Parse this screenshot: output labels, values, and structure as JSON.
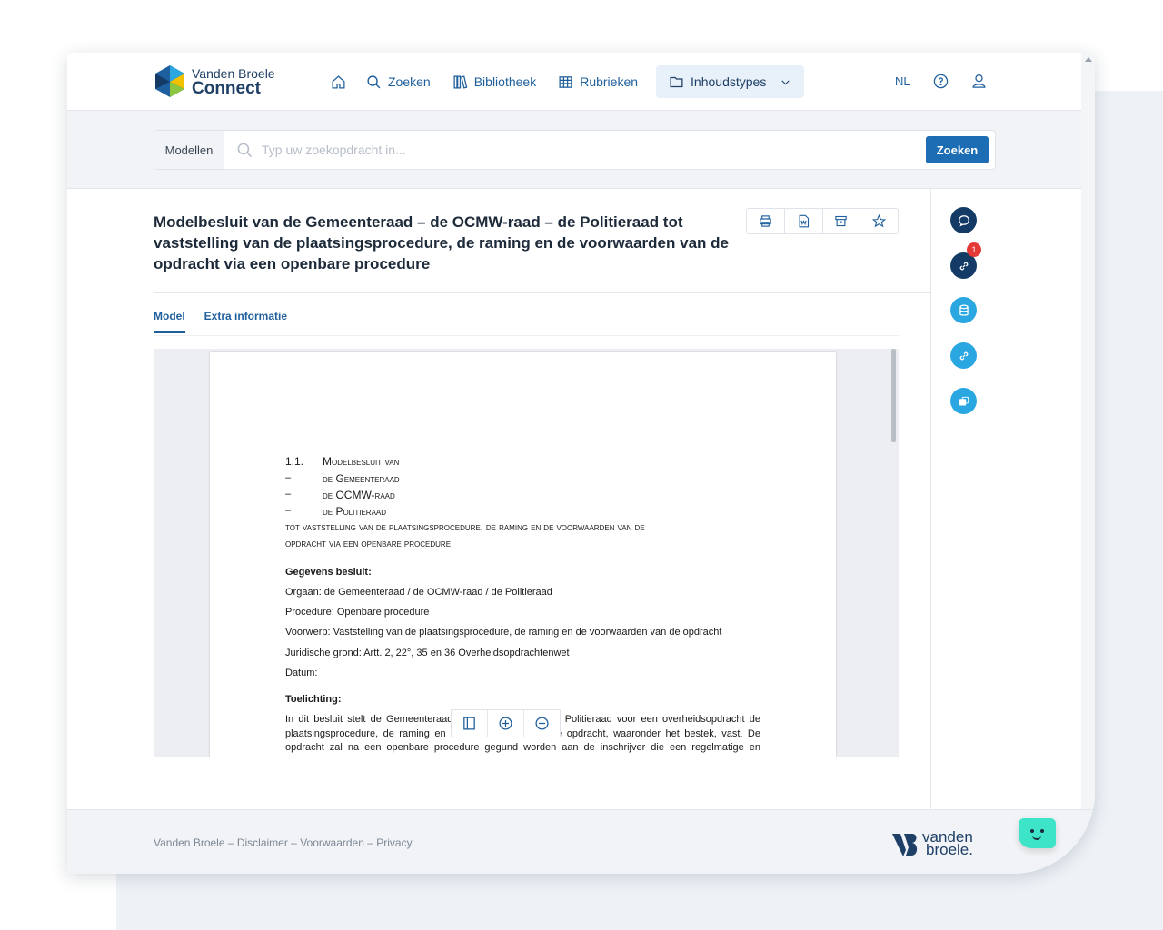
{
  "brand": {
    "name_top": "Vanden Broele",
    "name_bottom": "Connect"
  },
  "nav": {
    "items": [
      {
        "label": "Zoeken",
        "icon": "search-icon"
      },
      {
        "label": "Bibliotheek",
        "icon": "library-icon"
      },
      {
        "label": "Rubrieken",
        "icon": "grid-icon"
      },
      {
        "label": "Inhoudstypes",
        "icon": "folder-icon",
        "active": true
      }
    ],
    "language": "NL"
  },
  "search": {
    "scope": "Modellen",
    "placeholder": "Typ uw zoekopdracht in...",
    "button_label": "Zoeken"
  },
  "document": {
    "title": "Modelbesluit van de Gemeenteraad – de OCMW-raad – de Politieraad tot vaststelling van de plaatsingsprocedure, de raming en de voorwaarden van de opdracht via een openbare procedure",
    "actions": [
      "print-icon",
      "word-icon",
      "archive-icon",
      "star-icon"
    ],
    "tabs": [
      {
        "label": "Model",
        "active": true
      },
      {
        "label": "Extra informatie",
        "active": false
      }
    ]
  },
  "preview": {
    "section_number": "1.1.",
    "heading": "Modelbesluit van",
    "dash_lines": [
      "de Gemeenteraad",
      "de OCMW-raad",
      "de Politieraad"
    ],
    "dash": "–",
    "subheading_1": "tot vaststelling van de plaatsingsprocedure, de raming en de voorwaarden van de",
    "subheading_2": "opdracht via een openbare procedure",
    "gegevens_label": "Gegevens besluit:",
    "fields": [
      "Orgaan: de Gemeenteraad / de OCMW-raad / de Politieraad",
      "Procedure: Openbare procedure",
      "Voorwerp: Vaststelling van de plaatsingsprocedure, de raming en de voorwaarden van de opdracht",
      "Juridische grond: Artt. 2, 22°, 35 en 36 Overheidsopdrachtenwet",
      "Datum:"
    ],
    "toelichting_label": "Toelichting:",
    "toelichting_text": "In dit besluit stelt de Gemeenteraad / de OCMW-raad / de Politieraad voor een overheidsopdracht de plaatsingsprocedure, de raming en de voorwaarden van de opdracht, waaronder het bestek, vast. De opdracht zal na een openbare procedure gegund worden aan de inschrijver die een regelmatige en economisch meest voordelige offerte heeft ingediend."
  },
  "zoom_controls": [
    "sidebar-toggle-icon",
    "zoom-in-icon",
    "zoom-out-icon"
  ],
  "rail": [
    {
      "icon": "comment-icon",
      "style": "dark"
    },
    {
      "icon": "link-icon",
      "style": "dark",
      "badge": "1"
    },
    {
      "icon": "database-icon",
      "style": "light"
    },
    {
      "icon": "link-icon",
      "style": "light"
    },
    {
      "icon": "copy-icon",
      "style": "light"
    }
  ],
  "footer": {
    "links": "Vanden Broele – Disclaimer – Voorwaarden – Privacy",
    "logo_line1": "vanden",
    "logo_line2": "broele."
  },
  "colors": {
    "primary": "#1d6db5",
    "navy": "#143b66",
    "light_blue": "#2aa7e0",
    "badge": "#e53935",
    "chat": "#3de4c8"
  }
}
